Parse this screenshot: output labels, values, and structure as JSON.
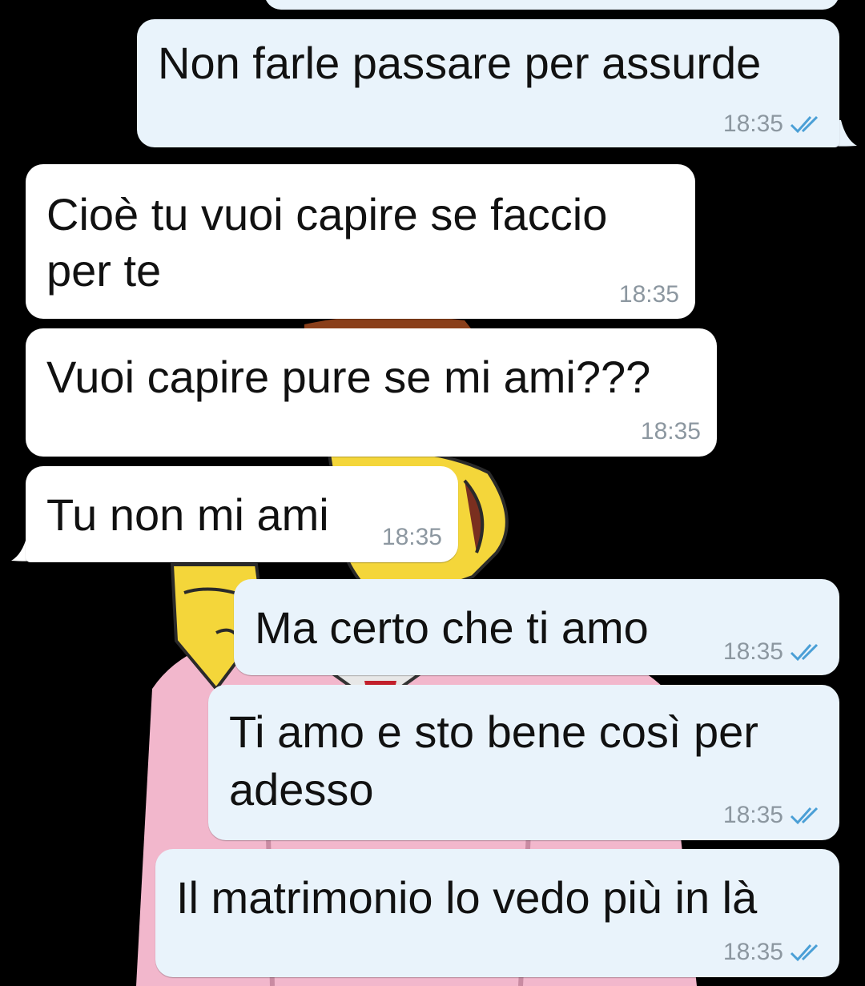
{
  "colors": {
    "outgoing_bubble": "#e9f3fb",
    "incoming_bubble": "#ffffff",
    "timestamp": "#8c97a0",
    "read_ticks": "#4a9fd6",
    "background": "#000000"
  },
  "messages": [
    {
      "direction": "outgoing",
      "text": "Non farle passare per assurde",
      "time": "18:35",
      "status": "read"
    },
    {
      "direction": "incoming",
      "lines": [
        "Cioè tu vuoi capire se faccio",
        "per te"
      ],
      "time": "18:35"
    },
    {
      "direction": "incoming",
      "text": "Vuoi capire pure se mi ami???",
      "time": "18:35"
    },
    {
      "direction": "incoming",
      "text": "Tu non mi ami",
      "time": "18:35"
    },
    {
      "direction": "outgoing",
      "text": "Ma certo che ti amo",
      "time": "18:35",
      "status": "read"
    },
    {
      "direction": "outgoing",
      "lines": [
        "Ti amo e sto bene così per",
        "adesso"
      ],
      "time": "18:35",
      "status": "read"
    },
    {
      "direction": "outgoing",
      "text": "Il matrimonio lo vedo più in là",
      "time": "18:35",
      "status": "read"
    }
  ],
  "icons": {
    "read_status": "double-check-icon",
    "wallpaper": "cartoon-character-wallpaper"
  }
}
